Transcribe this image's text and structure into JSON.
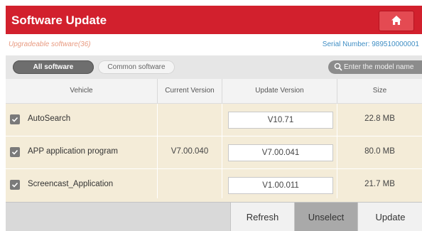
{
  "header": {
    "title": "Software Update",
    "home_icon": "home-icon"
  },
  "info": {
    "upgradeable": "Upgradeable software(36)",
    "serial": "Serial Number:  989510000001"
  },
  "tabs": {
    "all": "All software",
    "common": "Common software"
  },
  "search": {
    "placeholder": "Enter the model name",
    "icon": "search-icon"
  },
  "table": {
    "headers": {
      "vehicle": "Vehicle",
      "current": "Current Version",
      "update": "Update Version",
      "size": "Size"
    },
    "rows": [
      {
        "name": "AutoSearch",
        "current": "",
        "update": "V10.71",
        "size": "22.8 MB",
        "checked": true
      },
      {
        "name": "APP application program",
        "current": "V7.00.040",
        "update": "V7.00.041",
        "size": "80.0 MB",
        "checked": true
      },
      {
        "name": "Screencast_Application",
        "current": "",
        "update": "V1.00.011",
        "size": "21.7 MB",
        "checked": true
      }
    ]
  },
  "buttons": {
    "refresh": "Refresh",
    "unselect": "Unselect",
    "update": "Update"
  },
  "colors": {
    "header": "#d2202d",
    "row": "#f4ecd8",
    "accent_link": "#3f8ec4"
  }
}
